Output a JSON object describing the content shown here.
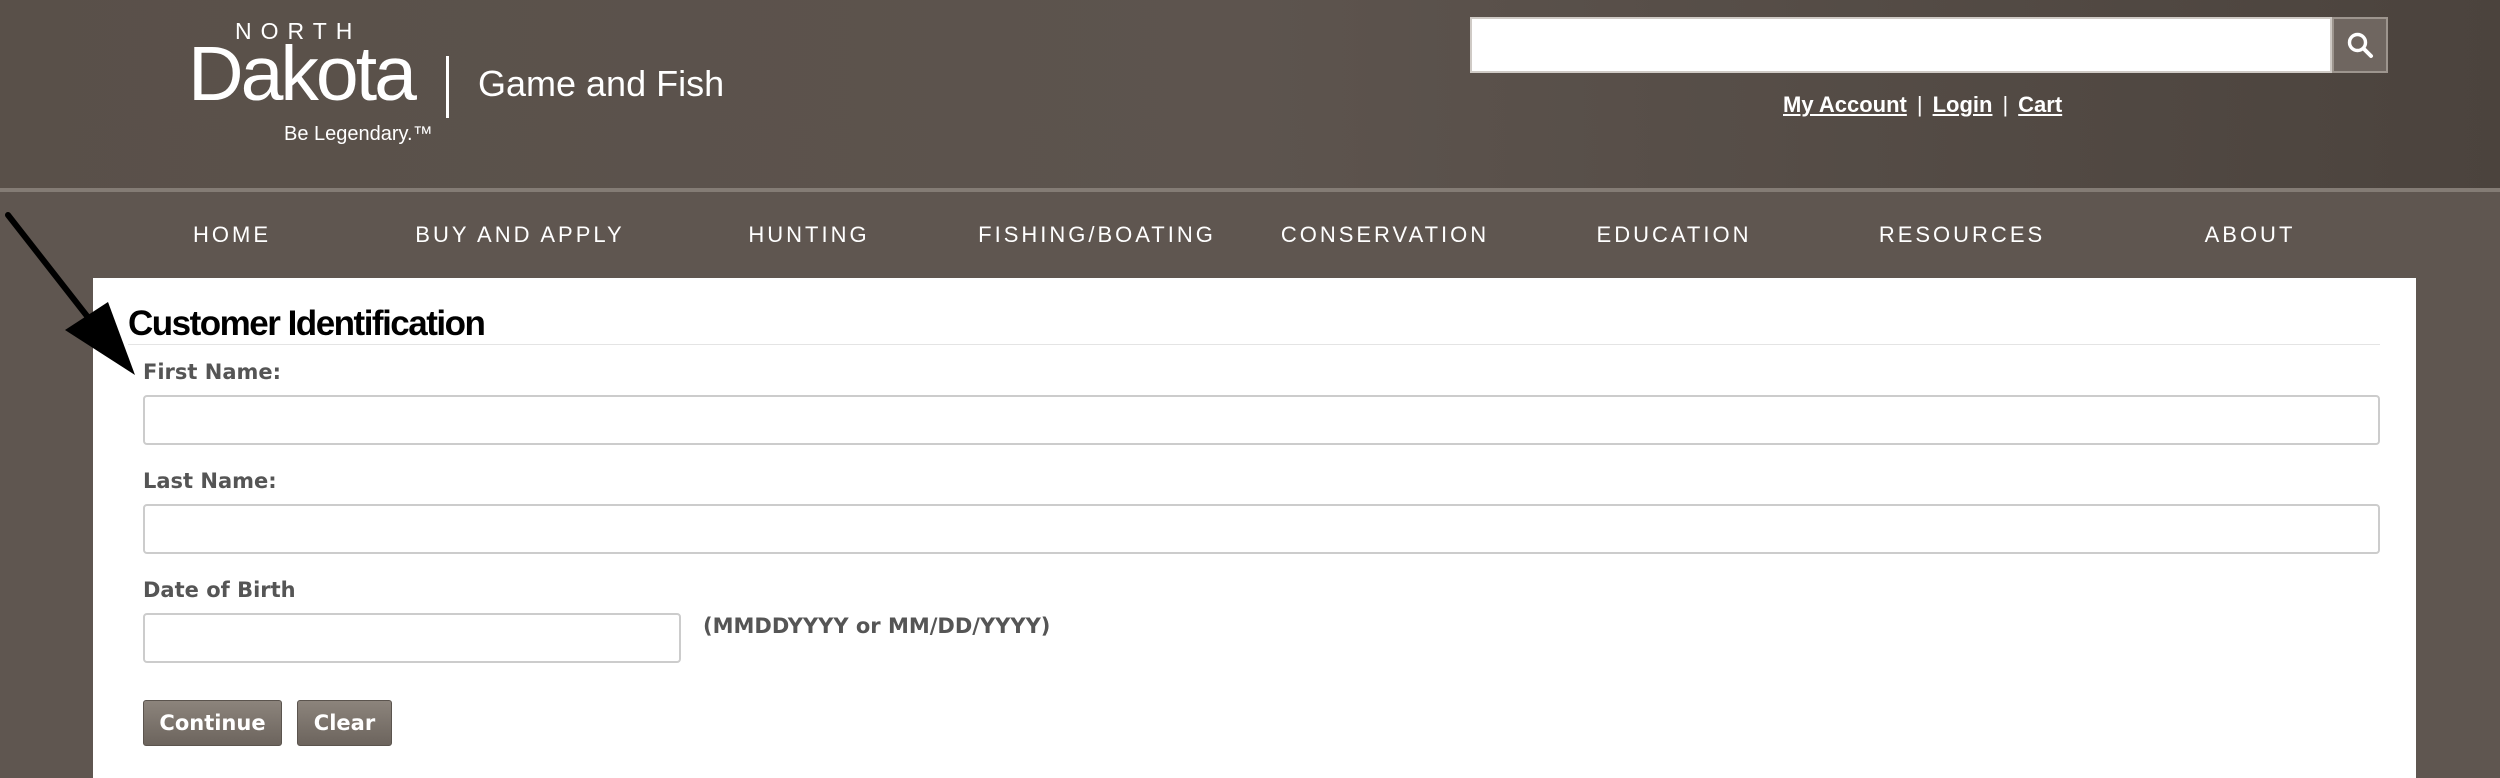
{
  "header": {
    "logo": {
      "north": "NORTH",
      "dakota": "Dakota",
      "tagline": "Be Legendary.™",
      "agency": "Game and Fish"
    },
    "search": {
      "value": "",
      "icon": "search-icon"
    },
    "account_links": {
      "my_account": "My Account",
      "login": "Login",
      "cart": "Cart",
      "separator": "|"
    }
  },
  "nav": {
    "items": [
      {
        "label": "HOME"
      },
      {
        "label": "BUY AND APPLY"
      },
      {
        "label": "HUNTING"
      },
      {
        "label": "FISHING/BOATING"
      },
      {
        "label": "CONSERVATION"
      },
      {
        "label": "EDUCATION"
      },
      {
        "label": "RESOURCES"
      },
      {
        "label": "ABOUT"
      }
    ]
  },
  "form": {
    "title": "Customer Identification",
    "first_name": {
      "label": "First Name:",
      "value": ""
    },
    "last_name": {
      "label": "Last Name:",
      "value": ""
    },
    "dob": {
      "label": "Date of Birth",
      "value": "",
      "hint": "(MMDDYYYY or MM/DD/YYYY)"
    },
    "buttons": {
      "continue": "Continue",
      "clear": "Clear"
    }
  },
  "colors": {
    "header_bg": "#5d544e",
    "panel_bg": "#ffffff",
    "button_bg": "#7a726b",
    "label_text": "#555555"
  }
}
